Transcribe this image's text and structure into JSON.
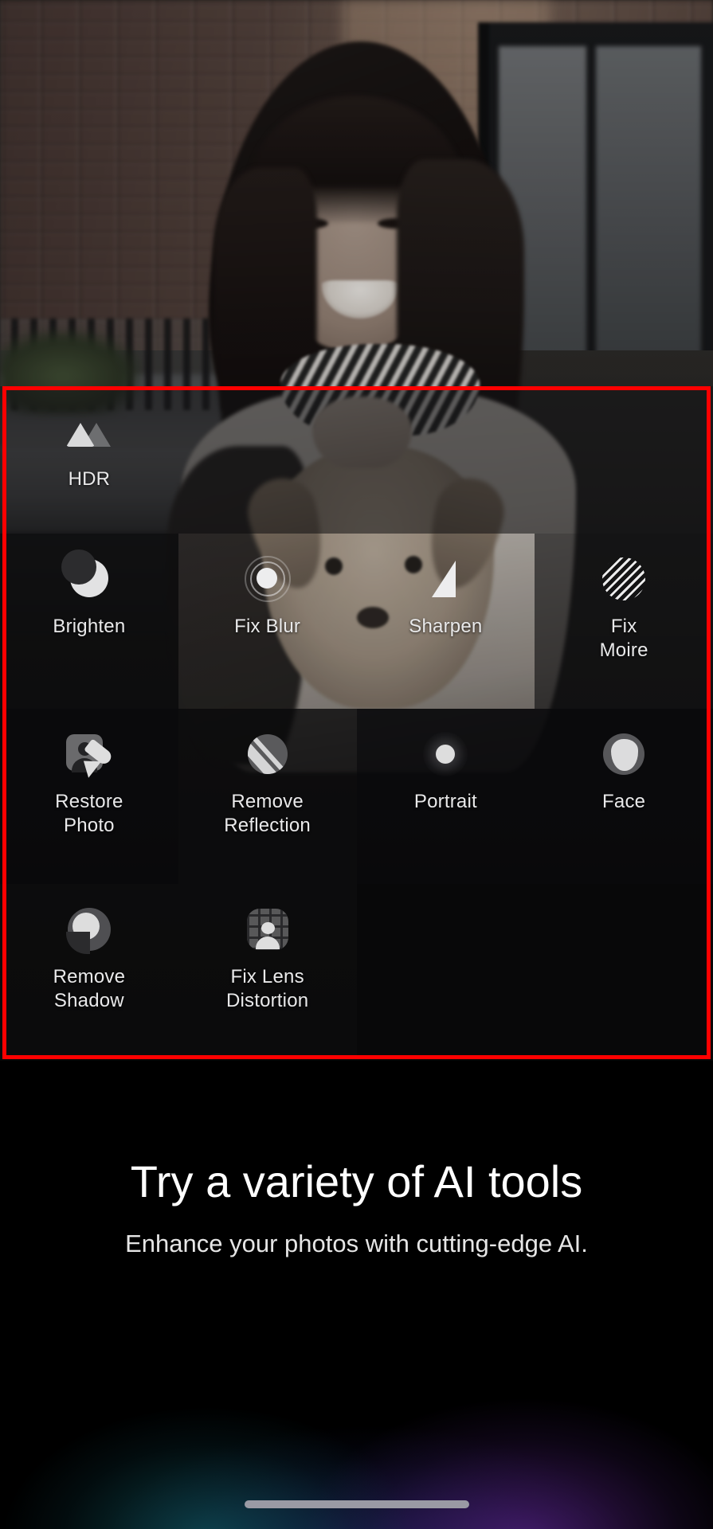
{
  "app": {
    "screen_name": "AI tools showcase",
    "background_description": "Desaturated photo of a smiling woman holding a small poodle in front of a brick building"
  },
  "tool_grid": {
    "rows": [
      {
        "cells": [
          {
            "label": "HDR",
            "icon": "hdr-mountains-icon",
            "shade": "shade-a",
            "empty": false
          },
          {
            "label": "",
            "icon": "",
            "shade": "shade-a",
            "empty": true
          },
          {
            "label": "",
            "icon": "",
            "shade": "shade-a",
            "empty": true
          },
          {
            "label": "",
            "icon": "",
            "shade": "shade-a",
            "empty": true
          }
        ]
      },
      {
        "cells": [
          {
            "label": "Brighten",
            "icon": "crescent-moon-icon",
            "shade": "shade-c",
            "empty": false
          },
          {
            "label": "Fix Blur",
            "icon": "focus-rings-icon",
            "shade": "shade-b",
            "empty": false
          },
          {
            "label": "Sharpen",
            "icon": "triangle-sharpen-icon",
            "shade": "shade-b",
            "empty": false
          },
          {
            "label": "Fix\nMoire",
            "icon": "striped-circle-icon",
            "shade": "shade-e",
            "empty": false
          }
        ]
      },
      {
        "cells": [
          {
            "label": "Restore\nPhoto",
            "icon": "portrait-brush-icon",
            "shade": "shade-d",
            "empty": false
          },
          {
            "label": "Remove\nReflection",
            "icon": "glare-circle-icon",
            "shade": "shade-c",
            "empty": false
          },
          {
            "label": "Portrait",
            "icon": "bokeh-dot-icon",
            "shade": "shade-d",
            "empty": false
          },
          {
            "label": "Face",
            "icon": "face-silhouette-icon",
            "shade": "shade-d",
            "empty": false
          }
        ]
      },
      {
        "cells": [
          {
            "label": "Remove\nShadow",
            "icon": "shadow-sphere-icon",
            "shade": "shade-c",
            "empty": false
          },
          {
            "label": "Fix Lens\nDistortion",
            "icon": "lens-grid-person-icon",
            "shade": "shade-c",
            "empty": false
          },
          {
            "label": "",
            "icon": "",
            "shade": "empty",
            "empty": true
          },
          {
            "label": "",
            "icon": "",
            "shade": "empty",
            "empty": true
          }
        ]
      }
    ]
  },
  "annotation": {
    "highlight_box_color": "#ff0000",
    "name": "tool-grid-highlight"
  },
  "caption": {
    "title": "Try a variety of AI tools",
    "subtitle": "Enhance your photos with cutting-edge AI."
  },
  "system": {
    "home_indicator": "home-indicator",
    "glow_colors": [
      "#146e78",
      "#6928a0",
      "#283796"
    ]
  }
}
